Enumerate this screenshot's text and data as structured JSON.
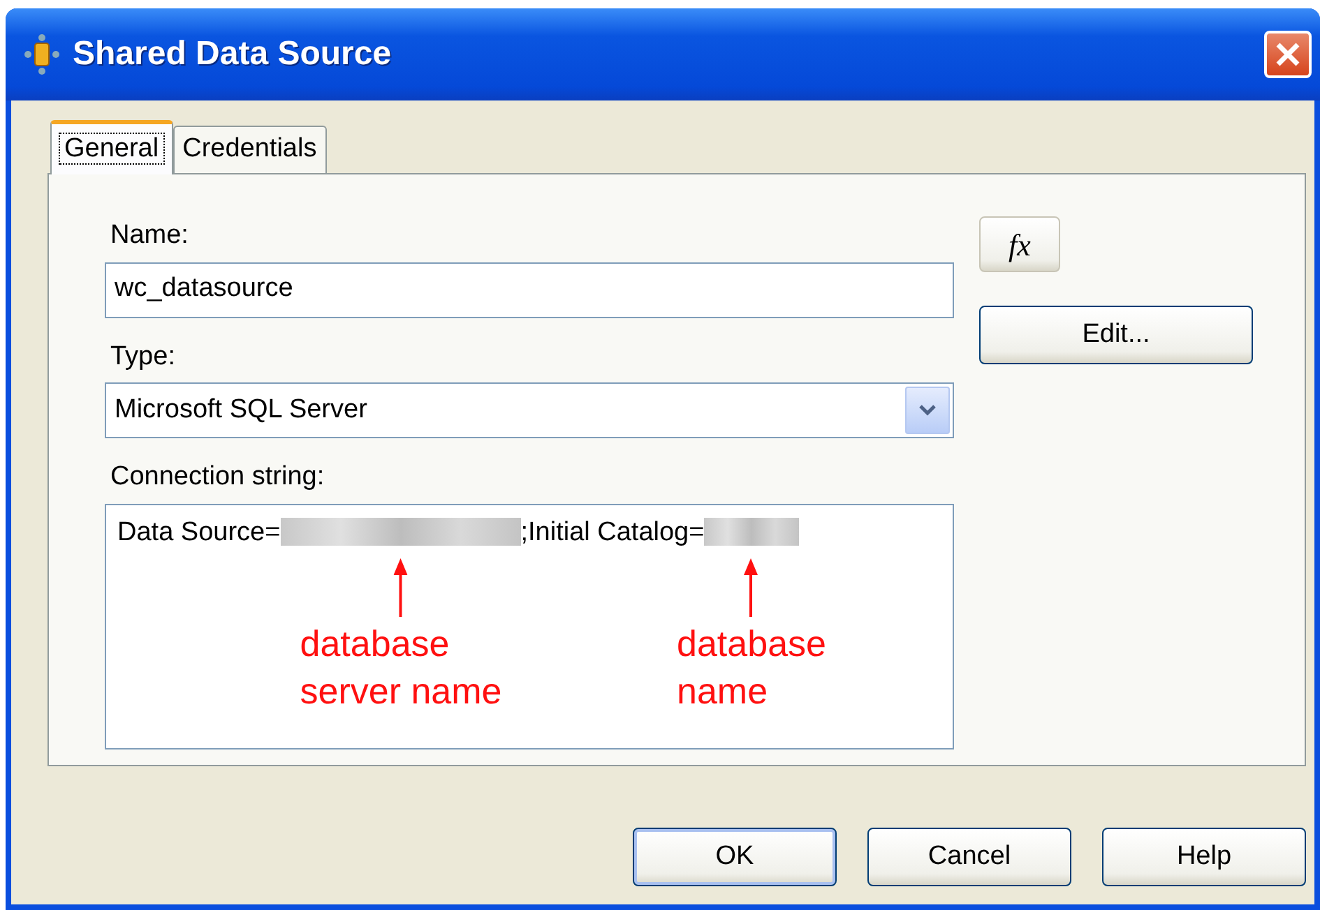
{
  "window": {
    "title": "Shared Data Source"
  },
  "tabs": [
    {
      "label": "General",
      "selected": true
    },
    {
      "label": "Credentials",
      "selected": false
    }
  ],
  "name_field": {
    "label": "Name:",
    "value": "wc_datasource"
  },
  "type_field": {
    "label": "Type:",
    "value": "Microsoft SQL Server"
  },
  "connection_string": {
    "label": "Connection string:",
    "segments": [
      {
        "kind": "text",
        "text": "Data Source="
      },
      {
        "kind": "redacted",
        "annotation": [
          "database",
          "server name"
        ]
      },
      {
        "kind": "text",
        "text": ";Initial Catalog="
      },
      {
        "kind": "redacted",
        "annotation": [
          "database",
          "name"
        ]
      }
    ]
  },
  "expression_button": {
    "label": "fx"
  },
  "edit_button": {
    "label": "Edit..."
  },
  "buttons": [
    {
      "label": "OK",
      "default": true
    },
    {
      "label": "Cancel",
      "default": false
    },
    {
      "label": "Help",
      "default": false
    }
  ]
}
